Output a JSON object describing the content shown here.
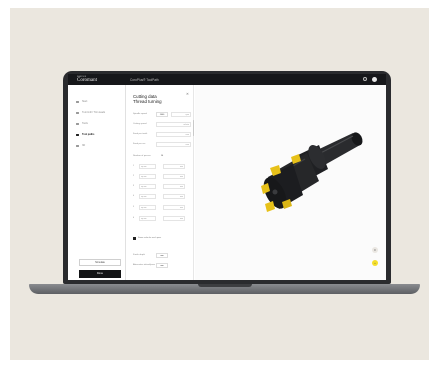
{
  "app": {
    "brand_small": "SANDVIK",
    "brand_main": "Coromant",
    "title": "CoroPlus® ToolPath"
  },
  "sidebar": {
    "items": [
      {
        "label": "Start"
      },
      {
        "label": "Turn/mill / Trim leads"
      },
      {
        "label": "Tools"
      },
      {
        "label": "Tool paths"
      },
      {
        "label": "3D"
      }
    ],
    "active_index": 3,
    "secondary_button": "Simulate",
    "primary_button": "Done"
  },
  "panel": {
    "title_line1": "Cutting data",
    "title_line2": "Thread turning",
    "rows": [
      {
        "label": "Spindle speed",
        "value": "1000",
        "value2": "rpm"
      },
      {
        "label": "Cutting speed",
        "value_wide": "m/min"
      },
      {
        "label": "Feed per tooth",
        "value_wide": "mm"
      },
      {
        "label": "Feed per rev",
        "value_wide": "mm"
      },
      {
        "label": "Number of passes",
        "value": "10"
      }
    ],
    "grid": [
      {
        "label": "1",
        "a": "ap mm",
        "b": "mm"
      },
      {
        "label": "2",
        "a": "ap mm",
        "b": "mm"
      },
      {
        "label": "3",
        "a": "ap mm",
        "b": "mm"
      },
      {
        "label": "4",
        "a": "ap mm",
        "b": "mm"
      },
      {
        "label": "5",
        "a": "ap mm",
        "b": "mm"
      },
      {
        "label": "6",
        "a": "ap mm",
        "b": "mm"
      }
    ],
    "checkbox_label": "Same value for each pass",
    "bottom_rows": [
      {
        "label": "Finish depth",
        "value": "mm"
      },
      {
        "label": "Alternative infeed/pass",
        "value": "mm"
      }
    ]
  },
  "viewer": {
    "model": "milling-cutter-3d-model",
    "colors": {
      "body": "#1f2023",
      "insert": "#e7c119",
      "accent": "#f5df2a"
    }
  }
}
